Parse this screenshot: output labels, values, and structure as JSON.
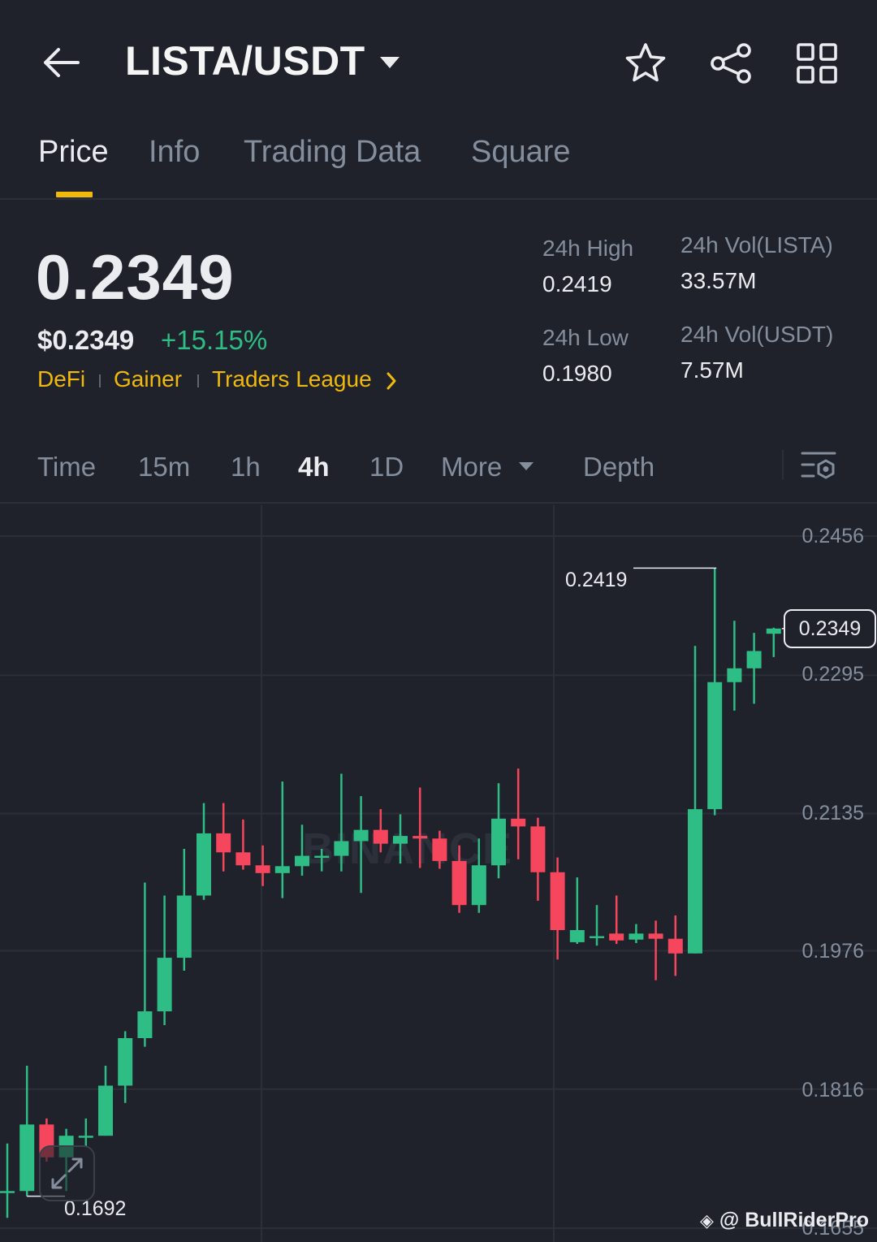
{
  "header": {
    "pair": "LISTA/USDT",
    "icons": [
      "back-arrow-icon",
      "caret-down-icon",
      "star-icon",
      "share-icon",
      "grid-icon"
    ]
  },
  "tabs": [
    {
      "label": "Price",
      "active": true
    },
    {
      "label": "Info",
      "active": false
    },
    {
      "label": "Trading Data",
      "active": false
    },
    {
      "label": "Square",
      "active": false
    }
  ],
  "ticker": {
    "last_price": "0.2349",
    "fiat_price": "$0.2349",
    "change_pct": "+15.15%",
    "tags": [
      "DeFi",
      "Gainer",
      "Traders League"
    ]
  },
  "stats": {
    "high_label": "24h High",
    "high_value": "0.2419",
    "low_label": "24h Low",
    "low_value": "0.1980",
    "vol_base_label": "24h Vol(LISTA)",
    "vol_base_value": "33.57M",
    "vol_quote_label": "24h Vol(USDT)",
    "vol_quote_value": "7.57M"
  },
  "intervals": [
    {
      "label": "Time",
      "active": false
    },
    {
      "label": "15m",
      "active": false
    },
    {
      "label": "1h",
      "active": false
    },
    {
      "label": "4h",
      "active": true
    },
    {
      "label": "1D",
      "active": false
    },
    {
      "label": "More",
      "active": false
    },
    {
      "label": "Depth",
      "active": false
    }
  ],
  "colors": {
    "up": "#2ebd85",
    "down": "#f6465d",
    "accent": "#f0b90b",
    "background": "#1f222b"
  },
  "chart_data": {
    "type": "candlestick",
    "y_ticks": [
      "0.2456",
      "0.2295",
      "0.2135",
      "0.1976",
      "0.1816",
      "0.1655"
    ],
    "ylim": [
      0.1655,
      0.2456
    ],
    "current_price": "0.2349",
    "high_marker": "0.2419",
    "low_marker": "0.1692",
    "candles": [
      {
        "o": 0.1698,
        "h": 0.1753,
        "l": 0.1667,
        "c": 0.1698
      },
      {
        "o": 0.1698,
        "h": 0.1843,
        "l": 0.1692,
        "c": 0.1775
      },
      {
        "o": 0.1775,
        "h": 0.1782,
        "l": 0.1732,
        "c": 0.1737
      },
      {
        "o": 0.1737,
        "h": 0.177,
        "l": 0.1698,
        "c": 0.1762
      },
      {
        "o": 0.1762,
        "h": 0.1782,
        "l": 0.175,
        "c": 0.1762
      },
      {
        "o": 0.1762,
        "h": 0.1843,
        "l": 0.1762,
        "c": 0.182
      },
      {
        "o": 0.182,
        "h": 0.1883,
        "l": 0.18,
        "c": 0.1875
      },
      {
        "o": 0.1875,
        "h": 0.2055,
        "l": 0.1865,
        "c": 0.1906
      },
      {
        "o": 0.1906,
        "h": 0.204,
        "l": 0.189,
        "c": 0.1968
      },
      {
        "o": 0.1968,
        "h": 0.2094,
        "l": 0.1953,
        "c": 0.204
      },
      {
        "o": 0.204,
        "h": 0.2147,
        "l": 0.2035,
        "c": 0.2112
      },
      {
        "o": 0.2112,
        "h": 0.2147,
        "l": 0.2068,
        "c": 0.209
      },
      {
        "o": 0.209,
        "h": 0.2128,
        "l": 0.207,
        "c": 0.2075
      },
      {
        "o": 0.2075,
        "h": 0.2098,
        "l": 0.2051,
        "c": 0.2066
      },
      {
        "o": 0.2066,
        "h": 0.2172,
        "l": 0.2037,
        "c": 0.2074
      },
      {
        "o": 0.2074,
        "h": 0.2122,
        "l": 0.2063,
        "c": 0.2086
      },
      {
        "o": 0.2086,
        "h": 0.2094,
        "l": 0.2068,
        "c": 0.2086
      },
      {
        "o": 0.2086,
        "h": 0.2181,
        "l": 0.2068,
        "c": 0.2103
      },
      {
        "o": 0.2103,
        "h": 0.2155,
        "l": 0.2043,
        "c": 0.2116
      },
      {
        "o": 0.2116,
        "h": 0.214,
        "l": 0.209,
        "c": 0.21
      },
      {
        "o": 0.21,
        "h": 0.2134,
        "l": 0.2077,
        "c": 0.2109
      },
      {
        "o": 0.2109,
        "h": 0.2165,
        "l": 0.2072,
        "c": 0.2106
      },
      {
        "o": 0.2106,
        "h": 0.2115,
        "l": 0.2071,
        "c": 0.208
      },
      {
        "o": 0.208,
        "h": 0.2098,
        "l": 0.202,
        "c": 0.2029
      },
      {
        "o": 0.2029,
        "h": 0.2106,
        "l": 0.202,
        "c": 0.2075
      },
      {
        "o": 0.2075,
        "h": 0.217,
        "l": 0.206,
        "c": 0.2129
      },
      {
        "o": 0.2129,
        "h": 0.2187,
        "l": 0.2082,
        "c": 0.212
      },
      {
        "o": 0.212,
        "h": 0.213,
        "l": 0.2034,
        "c": 0.2067
      },
      {
        "o": 0.2067,
        "h": 0.2084,
        "l": 0.1966,
        "c": 0.2
      },
      {
        "o": 0.1986,
        "h": 0.2061,
        "l": 0.1984,
        "c": 0.2
      },
      {
        "o": 0.1993,
        "h": 0.2029,
        "l": 0.1982,
        "c": 0.1993
      },
      {
        "o": 0.1996,
        "h": 0.204,
        "l": 0.1984,
        "c": 0.1988
      },
      {
        "o": 0.1989,
        "h": 0.2007,
        "l": 0.1985,
        "c": 0.1996
      },
      {
        "o": 0.1996,
        "h": 0.2011,
        "l": 0.1942,
        "c": 0.199
      },
      {
        "o": 0.199,
        "h": 0.2017,
        "l": 0.1947,
        "c": 0.1973
      },
      {
        "o": 0.1973,
        "h": 0.2329,
        "l": 0.1973,
        "c": 0.214
      },
      {
        "o": 0.214,
        "h": 0.2419,
        "l": 0.2133,
        "c": 0.2287
      },
      {
        "o": 0.2287,
        "h": 0.2358,
        "l": 0.2254,
        "c": 0.2303
      },
      {
        "o": 0.2303,
        "h": 0.2344,
        "l": 0.2262,
        "c": 0.2323
      },
      {
        "o": 0.2343,
        "h": 0.235,
        "l": 0.2316,
        "c": 0.2349
      }
    ]
  },
  "watermark": "BINANCE",
  "credit": "@ BullRiderPro"
}
